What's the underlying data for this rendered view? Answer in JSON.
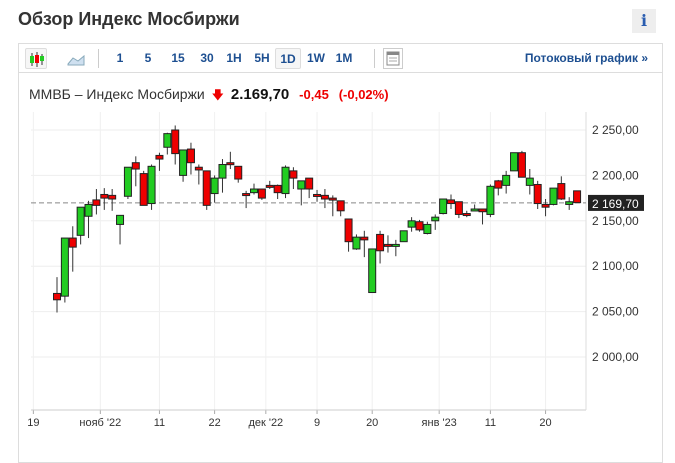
{
  "header": {
    "title": "Обзор Индекс Мосбиржи",
    "info_label": "i"
  },
  "toolbar": {
    "intervals": [
      "1",
      "5",
      "15",
      "30",
      "1H",
      "5H",
      "1D",
      "1W",
      "1M"
    ],
    "selected": "1D",
    "stream_label": "Потоковый график »"
  },
  "quote": {
    "name": "ММВБ – Индекс Мосбиржи",
    "last": "2.169,70",
    "change": "-0,45",
    "change_pct": "(-0,02%)"
  },
  "colors": {
    "up": "#22cc22",
    "down": "#ee0000",
    "link": "#1d4f91"
  },
  "chart_data": {
    "type": "candlestick",
    "ylim": [
      1940,
      2265
    ],
    "y_ticks": [
      {
        "v": 2250,
        "label": "2 250,00"
      },
      {
        "v": 2200,
        "label": "2 200,00"
      },
      {
        "v": 2150,
        "label": "2 150,00"
      },
      {
        "v": 2100,
        "label": "2 100,00"
      },
      {
        "v": 2050,
        "label": "2 050,00"
      },
      {
        "v": 2000,
        "label": "2 000,00"
      }
    ],
    "x_ticks": [
      {
        "i": -3,
        "label": "19"
      },
      {
        "i": 5.5,
        "label": "нояб '22"
      },
      {
        "i": 13,
        "label": "11"
      },
      {
        "i": 20,
        "label": "22"
      },
      {
        "i": 26.5,
        "label": "дек '22"
      },
      {
        "i": 33,
        "label": "9"
      },
      {
        "i": 40,
        "label": "20"
      },
      {
        "i": 48.5,
        "label": "янв '23"
      },
      {
        "i": 55,
        "label": "11"
      },
      {
        "i": 62,
        "label": "20"
      }
    ],
    "last_price": {
      "v": 2169.7,
      "label": "2 169,70"
    },
    "ohlc": [
      [
        2070,
        2088,
        2049,
        2063
      ],
      [
        2067,
        2131,
        2060,
        2131
      ],
      [
        2131,
        2144,
        2094,
        2121
      ],
      [
        2134,
        2165,
        2124,
        2165
      ],
      [
        2155,
        2172,
        2131,
        2168
      ],
      [
        2173,
        2185,
        2157,
        2167
      ],
      [
        2179,
        2186,
        2162,
        2175
      ],
      [
        2178,
        2185,
        2161,
        2174
      ],
      [
        2146,
        2156,
        2124,
        2156
      ],
      [
        2177,
        2209,
        2174,
        2209
      ],
      [
        2214,
        2221,
        2188,
        2207
      ],
      [
        2202,
        2205,
        2167,
        2167
      ],
      [
        2169,
        2212,
        2162,
        2210
      ],
      [
        2222,
        2225,
        2205,
        2218
      ],
      [
        2231,
        2247,
        2223,
        2246
      ],
      [
        2250,
        2255,
        2212,
        2224
      ],
      [
        2200,
        2228,
        2193,
        2228
      ],
      [
        2229,
        2236,
        2201,
        2214
      ],
      [
        2209,
        2212,
        2190,
        2206
      ],
      [
        2205,
        2205,
        2162,
        2167
      ],
      [
        2180,
        2200,
        2170,
        2197
      ],
      [
        2197,
        2218,
        2181,
        2212
      ],
      [
        2214,
        2226,
        2207,
        2212
      ],
      [
        2210,
        2210,
        2192,
        2196
      ],
      [
        2180,
        2183,
        2164,
        2178
      ],
      [
        2181,
        2191,
        2179,
        2185
      ],
      [
        2185,
        2185,
        2173,
        2175
      ],
      [
        2189,
        2194,
        2185,
        2187
      ],
      [
        2189,
        2190,
        2174,
        2181
      ],
      [
        2180,
        2211,
        2175,
        2209
      ],
      [
        2205,
        2209,
        2185,
        2197
      ],
      [
        2185,
        2194,
        2167,
        2194
      ],
      [
        2197,
        2197,
        2175,
        2185
      ],
      [
        2179,
        2184,
        2171,
        2177
      ],
      [
        2178,
        2185,
        2164,
        2174
      ],
      [
        2175,
        2178,
        2155,
        2173
      ],
      [
        2172,
        2172,
        2155,
        2161
      ],
      [
        2152,
        2152,
        2116,
        2127
      ],
      [
        2119,
        2135,
        2118,
        2132
      ],
      [
        2132,
        2139,
        2110,
        2129
      ],
      [
        2071,
        2119,
        2071,
        2119
      ],
      [
        2135,
        2139,
        2103,
        2117
      ],
      [
        2124,
        2134,
        2115,
        2122
      ],
      [
        2122,
        2129,
        2111,
        2124
      ],
      [
        2127,
        2139,
        2127,
        2139
      ],
      [
        2143,
        2154,
        2138,
        2150
      ],
      [
        2149,
        2151,
        2138,
        2140
      ],
      [
        2136,
        2149,
        2135,
        2146
      ],
      [
        2150,
        2157,
        2140,
        2154
      ],
      [
        2158,
        2174,
        2157,
        2174
      ],
      [
        2173,
        2179,
        2163,
        2169
      ],
      [
        2171,
        2171,
        2153,
        2157
      ],
      [
        2158,
        2161,
        2154,
        2156
      ],
      [
        2161,
        2168,
        2161,
        2163
      ],
      [
        2163,
        2163,
        2146,
        2160
      ],
      [
        2157,
        2190,
        2154,
        2188
      ],
      [
        2194,
        2195,
        2178,
        2186
      ],
      [
        2189,
        2205,
        2180,
        2200
      ],
      [
        2205,
        2225,
        2205,
        2225
      ],
      [
        2225,
        2227,
        2198,
        2198
      ],
      [
        2189,
        2207,
        2179,
        2197
      ],
      [
        2190,
        2194,
        2163,
        2169
      ],
      [
        2168,
        2174,
        2155,
        2165
      ],
      [
        2168,
        2186,
        2167,
        2186
      ],
      [
        2191,
        2199,
        2173,
        2174
      ],
      [
        2168,
        2176,
        2162,
        2171
      ],
      [
        2183,
        2183,
        2170,
        2170
      ]
    ]
  }
}
